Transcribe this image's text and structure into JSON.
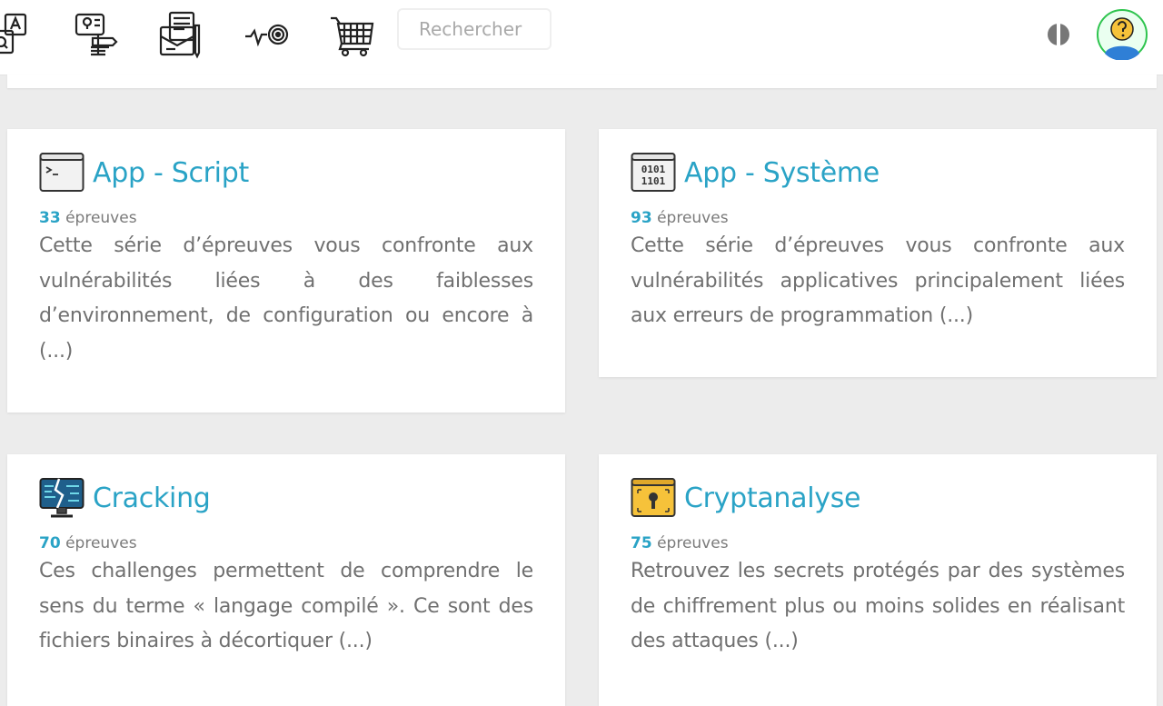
{
  "nav": {
    "icons": [
      "qa-documents-icon",
      "guide-signpost-icon",
      "documents-pen-icon",
      "target-pulse-icon",
      "cart-icon"
    ],
    "search_placeholder": "Rechercher",
    "lang_toggle_icon": "language-toggle-icon",
    "avatar_icon": "user-question-avatar-icon"
  },
  "cards": [
    {
      "title": "App - Script",
      "icon": "terminal-window-icon",
      "count": "33",
      "count_label": "épreuves",
      "description": "Cette série d’épreuves vous confronte aux vulnérabilités liées à des faiblesses d’environnement, de configuration ou encore à (...)"
    },
    {
      "title": "App - Système",
      "icon": "binary-window-icon",
      "count": "93",
      "count_label": "épreuves",
      "description": "Cette série d’épreuves vous confronte aux vulnérabilités applicatives principalement liées aux erreurs de programmation (...)"
    },
    {
      "title": "Cracking",
      "icon": "broken-monitor-icon",
      "count": "70",
      "count_label": "épreuves",
      "description": "Ces challenges permettent de comprendre le sens du terme « langage compilé ». Ce sont des fichiers binaires à décortiquer (...)"
    },
    {
      "title": "Cryptanalyse",
      "icon": "keyhole-lock-icon",
      "count": "75",
      "count_label": "épreuves",
      "description": "Retrouvez les secrets protégés par des systèmes de chiffrement plus ou moins solides en réalisant des attaques (...)"
    }
  ],
  "colors": {
    "accent": "#2aa3c6",
    "background": "#ececec",
    "card": "#ffffff",
    "text": "#707070"
  }
}
